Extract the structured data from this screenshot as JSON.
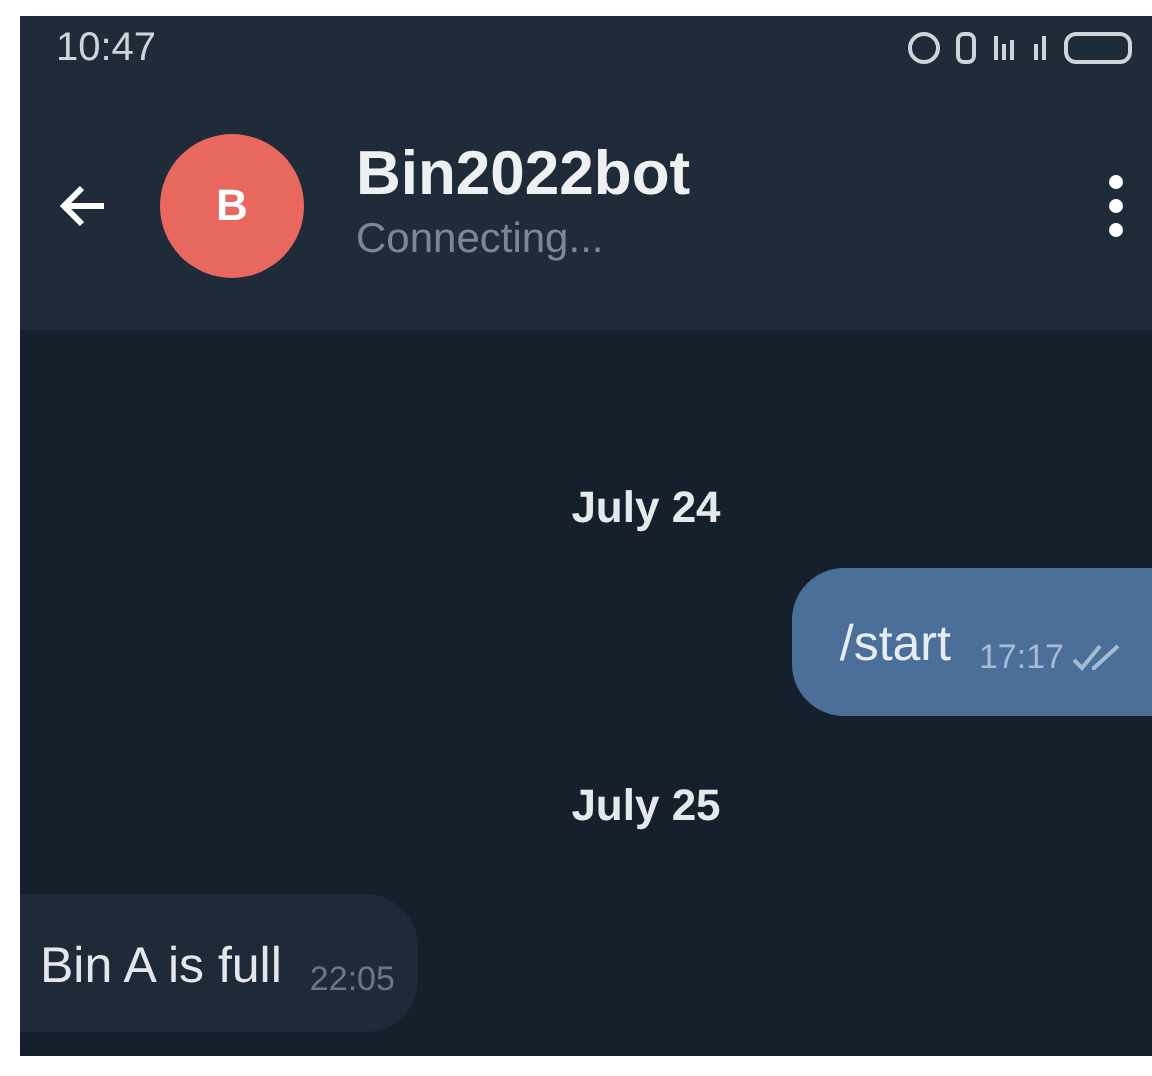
{
  "status_bar": {
    "time": "10:47"
  },
  "header": {
    "avatar_letter": "B",
    "title": "Bin2022bot",
    "subtitle": "Connecting..."
  },
  "messages": [
    {
      "kind": "date",
      "text": "July 24"
    },
    {
      "kind": "outgoing",
      "text": "/start",
      "time": "17:17",
      "read": true
    },
    {
      "kind": "date",
      "text": "July 25"
    },
    {
      "kind": "incoming",
      "text": "Bin A is full",
      "time": "22:05"
    }
  ]
}
